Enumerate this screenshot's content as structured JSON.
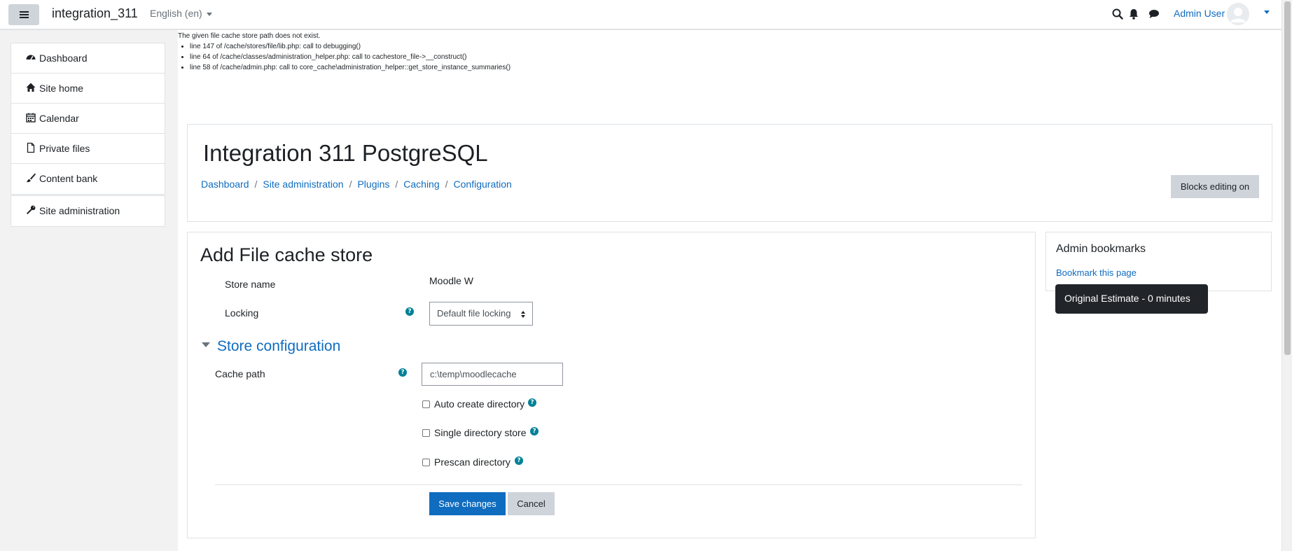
{
  "navbar": {
    "site_name": "integration_311",
    "language": "English (en)",
    "user_name": "Admin User"
  },
  "drawer": {
    "items": [
      {
        "label": "Dashboard",
        "icon": "dashboard-icon"
      },
      {
        "label": "Site home",
        "icon": "home-icon"
      },
      {
        "label": "Calendar",
        "icon": "calendar-icon"
      },
      {
        "label": "Private files",
        "icon": "file-icon"
      },
      {
        "label": "Content bank",
        "icon": "paintbrush-icon"
      }
    ],
    "admin_item": {
      "label": "Site administration",
      "icon": "wrench-icon"
    }
  },
  "debug": {
    "message": "The given file cache store path does not exist.",
    "lines": [
      "line 147 of /cache/stores/file/lib.php: call to debugging()",
      "line 64 of /cache/classes/administration_helper.php: call to cachestore_file->__construct()",
      "line 58 of /cache/admin.php: call to core_cache\\administration_helper::get_store_instance_summaries()"
    ]
  },
  "header": {
    "title": "Integration 311 PostgreSQL",
    "breadcrumbs": [
      "Dashboard",
      "Site administration",
      "Plugins",
      "Caching",
      "Configuration"
    ],
    "blocks_button": "Blocks editing on"
  },
  "form": {
    "title": "Add File cache store",
    "store_name_label": "Store name",
    "store_name_value": "Moodle W",
    "locking_label": "Locking",
    "locking_value": "Default file locking",
    "section_title": "Store configuration",
    "cache_path_label": "Cache path",
    "cache_path_value": "c:\\temp\\moodlecache",
    "checkboxes": [
      {
        "label": "Auto create directory",
        "checked": false
      },
      {
        "label": "Single directory store",
        "checked": false
      },
      {
        "label": "Prescan directory",
        "checked": false
      }
    ],
    "save_button": "Save changes",
    "cancel_button": "Cancel"
  },
  "bookmarks": {
    "title": "Admin bookmarks",
    "link": "Bookmark this page"
  },
  "tooltip": {
    "text": "Original Estimate - 0 minutes"
  },
  "colors": {
    "primary": "#0f6cbf",
    "help_icon": "#008196",
    "secondary_button": "#ced4da",
    "tooltip_bg": "#212529"
  }
}
